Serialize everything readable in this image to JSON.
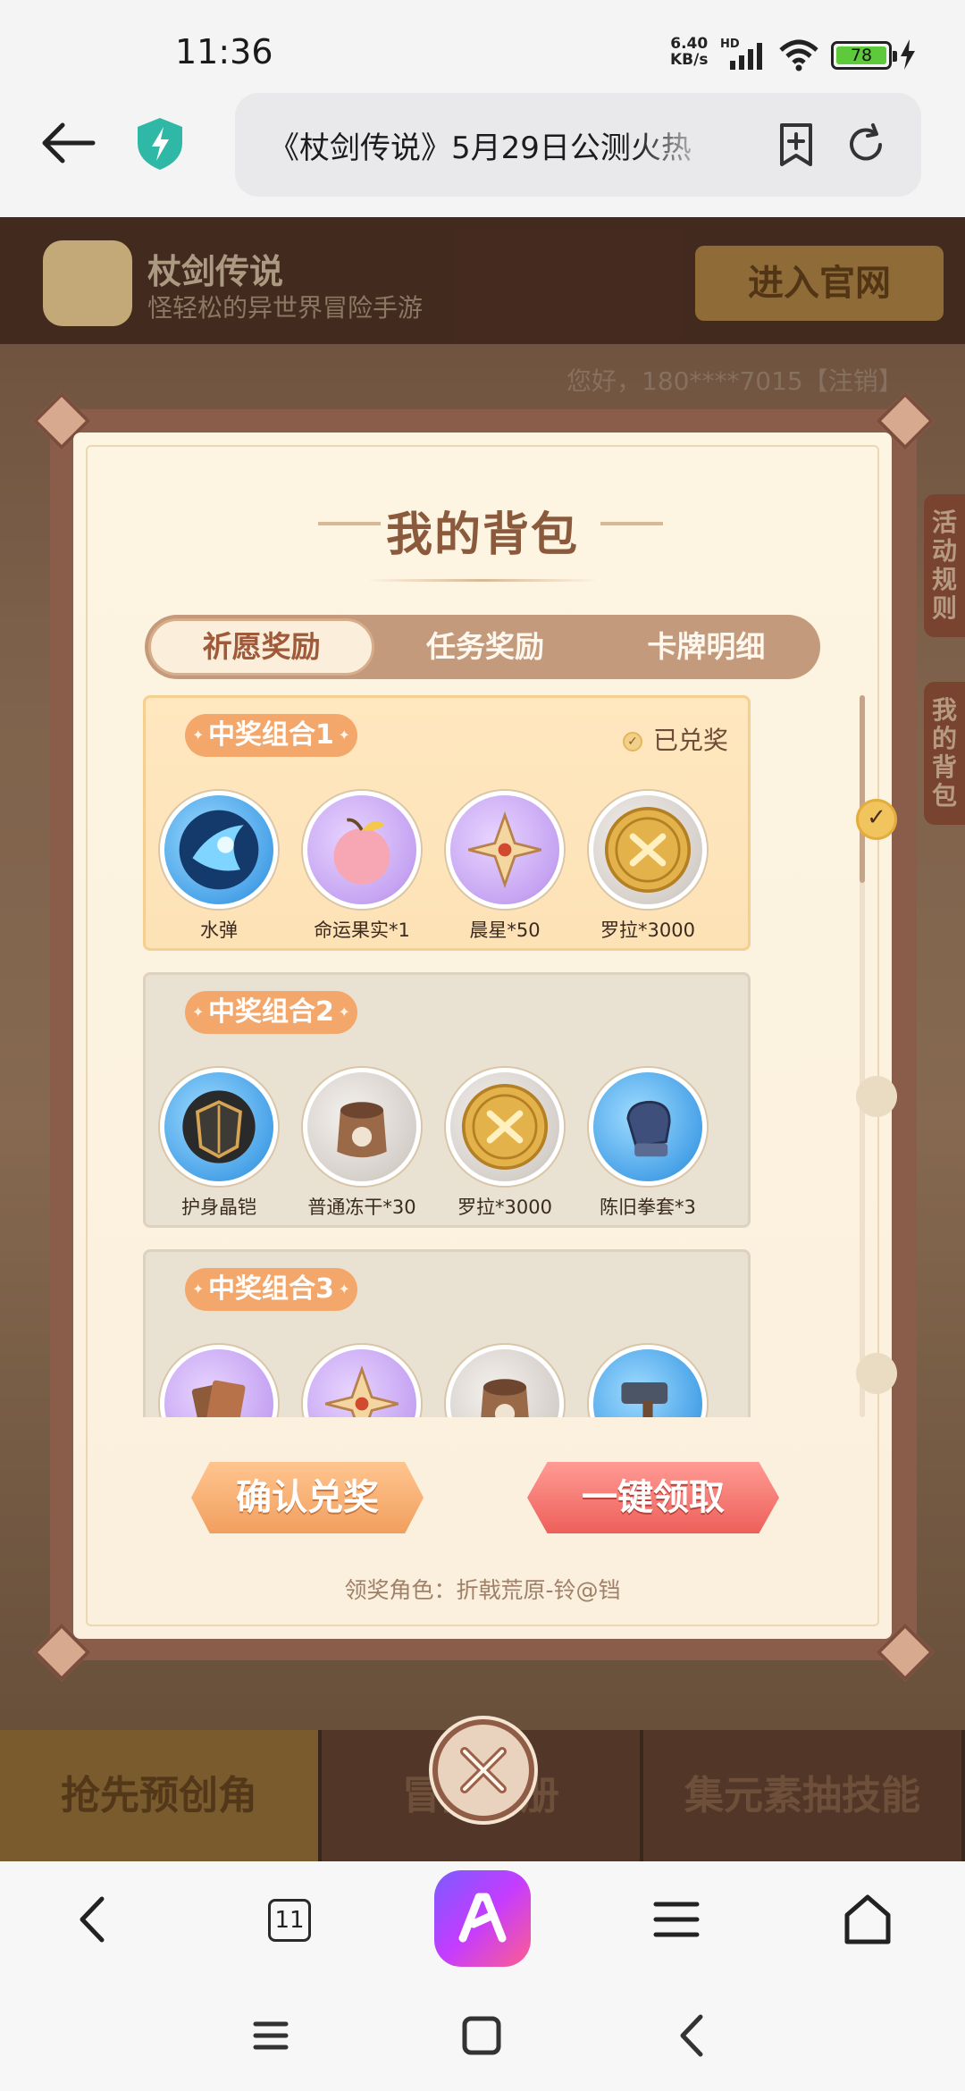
{
  "status_bar": {
    "time": "11:36",
    "net_speed_value": "6.40",
    "net_speed_unit": "KB/s",
    "network_type": "HD",
    "battery_level": "78",
    "icons": [
      "signal-icon",
      "wifi-icon",
      "battery-icon",
      "charging-icon"
    ]
  },
  "browser": {
    "url_title": "《杖剑传说》5月29日公测火热",
    "tab_count": "11"
  },
  "site": {
    "title": "杖剑传说",
    "subtitle": "怪轻松的异世界冒险手游",
    "official_button": "进入官网",
    "greeting": "您好，180****7015【注销】",
    "side_tabs": [
      "活动规则",
      "我的背包"
    ],
    "bottom_tabs": [
      "抢先预创角",
      "冒险手册",
      "集元素抽技能"
    ]
  },
  "modal": {
    "title": "我的背包",
    "tabs": [
      {
        "label": "祈愿奖励",
        "active": true
      },
      {
        "label": "任务奖励",
        "active": false
      },
      {
        "label": "卡牌明细",
        "active": false
      }
    ],
    "claimed_text": "已兑奖",
    "combos": [
      {
        "label": "中奖组合1",
        "claimed": true,
        "items": [
          {
            "name": "水弹",
            "icon": "water-bullet-icon",
            "bg": "blue"
          },
          {
            "name": "命运果实*1",
            "icon": "fate-fruit-icon",
            "bg": "purple"
          },
          {
            "name": "晨星*50",
            "icon": "morning-star-icon",
            "bg": "purple"
          },
          {
            "name": "罗拉*3000",
            "icon": "lola-coin-icon",
            "bg": "gray"
          }
        ]
      },
      {
        "label": "中奖组合2",
        "claimed": false,
        "items": [
          {
            "name": "护身晶铠",
            "icon": "crystal-armor-icon",
            "bg": "blue"
          },
          {
            "name": "普通冻干*30",
            "icon": "freeze-dried-bag-icon",
            "bg": "gray"
          },
          {
            "name": "罗拉*3000",
            "icon": "lola-coin-icon",
            "bg": "gray"
          },
          {
            "name": "陈旧拳套*3",
            "icon": "old-gauntlet-icon",
            "bg": "blue"
          }
        ]
      },
      {
        "label": "中奖组合3",
        "claimed": false,
        "items": [
          {
            "name": "",
            "icon": "card-pack-icon",
            "bg": "purple"
          },
          {
            "name": "",
            "icon": "morning-star-icon",
            "bg": "purple"
          },
          {
            "name": "",
            "icon": "freeze-dried-bag-icon",
            "bg": "gray"
          },
          {
            "name": "",
            "icon": "hammer-icon",
            "bg": "blue"
          }
        ]
      }
    ],
    "confirm_button": "确认兑奖",
    "claim_all_button": "一键领取",
    "role_line": "领奖角色：折戟荒原-铃@铛"
  },
  "colors": {
    "modal_bg": "#fdf4e2",
    "frame": "#8a5d4a",
    "claimed_bg": "#ffe7bf",
    "combo_label": "#f4a76a",
    "confirm_button": "#f19f5f",
    "claim_button": "#ee5f5a"
  }
}
